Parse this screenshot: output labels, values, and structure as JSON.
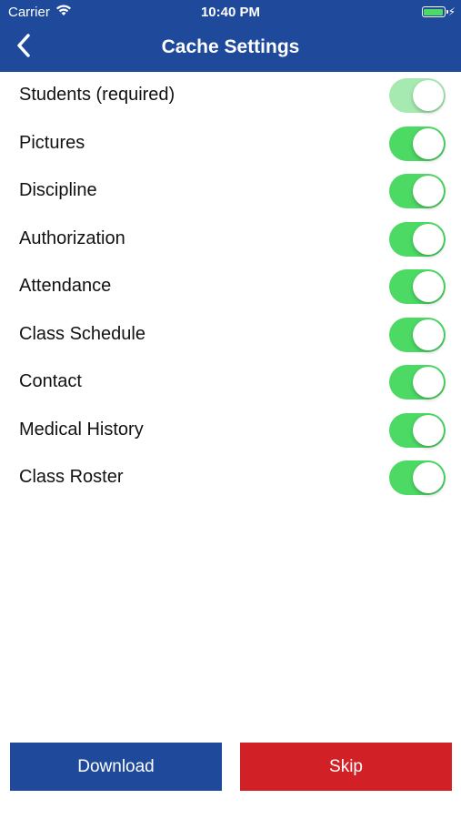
{
  "status_bar": {
    "carrier": "Carrier",
    "time": "10:40 PM",
    "battery_color": "#4cd964"
  },
  "header": {
    "title": "Cache Settings",
    "back_icon": "chevron-left-icon",
    "background": "#1f4a9c"
  },
  "settings": [
    {
      "label": "Students (required)",
      "on": true,
      "disabled": true
    },
    {
      "label": "Pictures",
      "on": true,
      "disabled": false
    },
    {
      "label": "Discipline",
      "on": true,
      "disabled": false
    },
    {
      "label": "Authorization",
      "on": true,
      "disabled": false
    },
    {
      "label": "Attendance",
      "on": true,
      "disabled": false
    },
    {
      "label": "Class Schedule",
      "on": true,
      "disabled": false
    },
    {
      "label": "Contact",
      "on": true,
      "disabled": false
    },
    {
      "label": "Medical History",
      "on": true,
      "disabled": false
    },
    {
      "label": "Class Roster",
      "on": true,
      "disabled": false
    }
  ],
  "actions": {
    "download_label": "Download",
    "skip_label": "Skip",
    "download_color": "#1f4a9c",
    "skip_color": "#d22027"
  },
  "colors": {
    "toggle_on": "#4cd964",
    "toggle_disabled": "#a6eab1"
  }
}
